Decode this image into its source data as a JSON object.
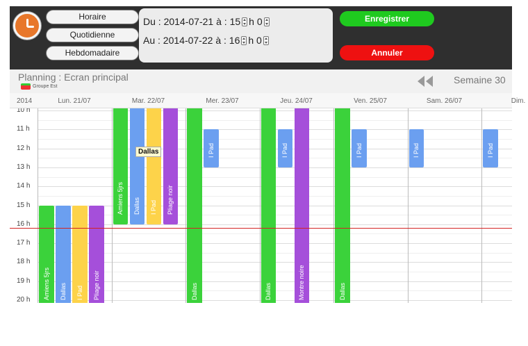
{
  "toolbar": {
    "modes": {
      "hourly": "Horaire",
      "daily": "Quotidienne",
      "weekly": "Hebdomadaire"
    },
    "range": {
      "from_label": "Du :",
      "from_date": "2014-07-21",
      "from_at": "à :",
      "from_hour": "15",
      "from_h": "h",
      "from_min": "0",
      "to_label": "Au :",
      "to_date": "2014-07-22",
      "to_at": "à :",
      "to_hour": "16",
      "to_h": "h",
      "to_min": "0"
    },
    "save_label": "Enregistrer",
    "cancel_label": "Annuler",
    "save_color": "#1fca1f",
    "cancel_color": "#ee1111"
  },
  "planning": {
    "title": "Planning : Ecran principal",
    "group": "Groupe Est",
    "week": "Semaine 30",
    "year": "2014"
  },
  "days": [
    "Lun. 21/07",
    "Mar. 22/07",
    "Mer. 23/07",
    "Jeu. 24/07",
    "Ven. 25/07",
    "Sam. 26/07",
    "Dim."
  ],
  "hours": [
    "10 h",
    "11 h",
    "12 h",
    "13 h",
    "14 h",
    "15 h",
    "16 h",
    "17 h",
    "18 h",
    "19 h",
    "20 h"
  ],
  "current_time": 16.2,
  "colors": {
    "green": "#3bd23b",
    "blue": "#6b9ff0",
    "yellow": "#fdd34a",
    "purple": "#a54fda",
    "now_line": "#d32222"
  },
  "events": [
    {
      "day": 0,
      "lane": 0,
      "start": 15,
      "end": 21,
      "color": "green",
      "label": "Amiens 5jrs"
    },
    {
      "day": 0,
      "lane": 1,
      "start": 15,
      "end": 21,
      "color": "blue",
      "label": "Dallas"
    },
    {
      "day": 0,
      "lane": 2,
      "start": 15,
      "end": 21,
      "color": "yellow",
      "label": "I Pad"
    },
    {
      "day": 0,
      "lane": 3,
      "start": 15,
      "end": 21,
      "color": "purple",
      "label": "Pliage noir"
    },
    {
      "day": 1,
      "lane": 0,
      "start": 9,
      "end": 16,
      "color": "green",
      "label": "Amiens 5jrs"
    },
    {
      "day": 1,
      "lane": 1,
      "start": 9,
      "end": 16,
      "color": "blue",
      "label": "Dallas"
    },
    {
      "day": 1,
      "lane": 2,
      "start": 9,
      "end": 16,
      "color": "yellow",
      "label": "I Pad"
    },
    {
      "day": 1,
      "lane": 3,
      "start": 9,
      "end": 16,
      "color": "purple",
      "label": "Pliage noir"
    },
    {
      "day": 2,
      "lane": 0,
      "start": 9,
      "end": 21,
      "color": "green",
      "label": "Dallas"
    },
    {
      "day": 2,
      "lane": 1,
      "start": 11,
      "end": 13,
      "color": "blue",
      "label": "I Pad"
    },
    {
      "day": 3,
      "lane": 0,
      "start": 9,
      "end": 21,
      "color": "green",
      "label": "Dallas"
    },
    {
      "day": 3,
      "lane": 1,
      "start": 11,
      "end": 13,
      "color": "blue",
      "label": "I Pad"
    },
    {
      "day": 3,
      "lane": 2,
      "start": 9,
      "end": 21,
      "color": "purple",
      "label": "Montre noire"
    },
    {
      "day": 4,
      "lane": 0,
      "start": 9,
      "end": 21,
      "color": "green",
      "label": "Dallas"
    },
    {
      "day": 4,
      "lane": 1,
      "start": 11,
      "end": 13,
      "color": "blue",
      "label": "I Pad"
    },
    {
      "day": 5,
      "lane": 0,
      "start": 11,
      "end": 13,
      "color": "blue",
      "label": "I Pad"
    },
    {
      "day": 6,
      "lane": 0,
      "start": 11,
      "end": 13,
      "color": "blue",
      "label": "I Pad"
    }
  ],
  "tooltip": "Dallas"
}
